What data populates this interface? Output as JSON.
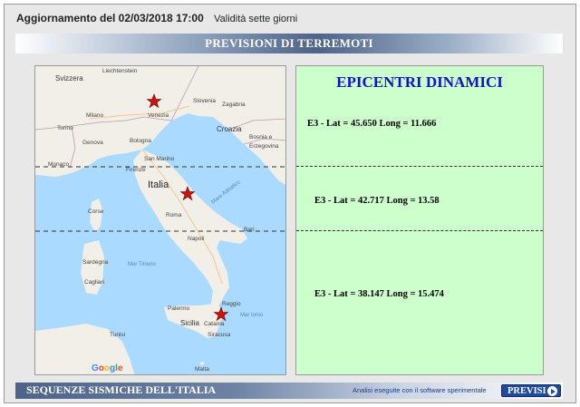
{
  "header": {
    "update_text": "Aggiornamento del 02/03/2018  17:00",
    "validity": "Validità sette giorni"
  },
  "banner": {
    "title": "PREVISIONI DI TERREMOTI"
  },
  "map": {
    "labels": {
      "svizzera": "Svizzera",
      "liechtenstein": "Liechtenstein",
      "milano": "Milano",
      "venezia": "Venezia",
      "slovenia": "Slovenia",
      "zagabria": "Zagabria",
      "torino": "Torino",
      "genova": "Genova",
      "bologna": "Bologna",
      "croazia": "Croazia",
      "bosnia": "Bosnia e",
      "erzegovina": "Erzegovina",
      "monaco": "Monaco",
      "san_marino": "San Marino",
      "firenze": "Firenze",
      "italia": "Italia",
      "roma": "Roma",
      "corse": "Corse",
      "bari": "Bari",
      "napoli": "Napoli",
      "sardegna": "Sardegna",
      "cagliari": "Cagliari",
      "mare_tirreno": "Mar Tirreno",
      "mare_adriatico": "Mare Adriatico",
      "mare_ionio": "Mar Ionio",
      "palermo": "Palermo",
      "sicilia": "Sicilia",
      "catania": "Catania",
      "siracusa": "Siracusa",
      "tunisi": "Tunisi",
      "malta": "Malta",
      "reggio": "Reggio",
      "google": "Google"
    }
  },
  "panel": {
    "title": "EPICENTRI DINAMICI",
    "lines": [
      "E3 - Lat = 45.650 Long = 11.666",
      "E3 - Lat = 42.717  Long = 13.58",
      "E3 - Lat = 38.147  Long = 15.474"
    ]
  },
  "footer": {
    "sequences": "SEQUENZE SISMICHE DELL'ITALIA",
    "analysis_note": "Analisi eseguite con il software sperimentale",
    "button": "PREVISI"
  },
  "colors": {
    "accent": "#1010d0",
    "panel_bg": "#ccffcc",
    "star": "#d21010",
    "sea": "#aadaff",
    "land": "#f2efe9"
  }
}
